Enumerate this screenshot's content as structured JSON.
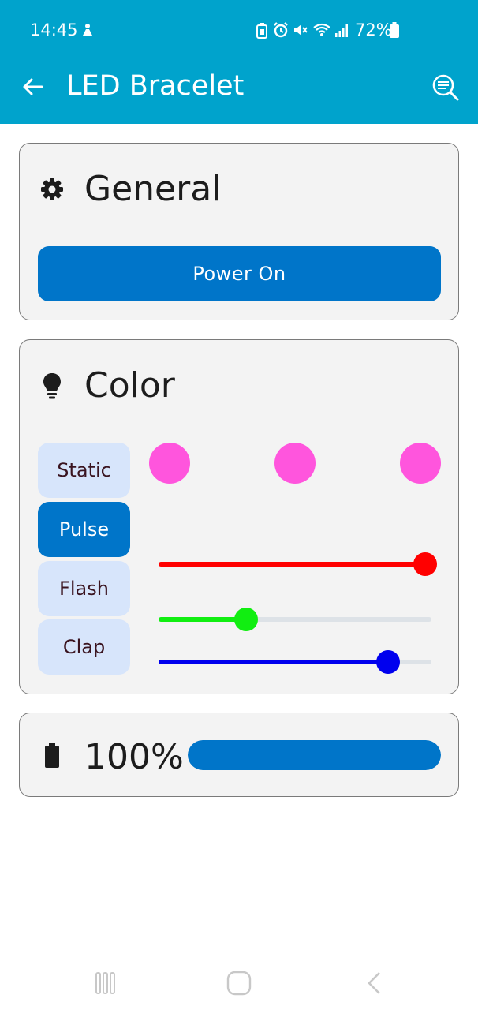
{
  "status_bar": {
    "time": "14:45",
    "battery_text": "72%",
    "icons": [
      "notification-icon",
      "battery-saver-icon",
      "alarm-icon",
      "mute-icon",
      "wifi-icon",
      "signal-icon",
      "battery-icon"
    ]
  },
  "app_bar": {
    "title": "LED Bracelet",
    "back_icon": "arrow-left-icon",
    "search_icon": "search-icon"
  },
  "general": {
    "title": "General",
    "icon": "gear-icon",
    "power_button": "Power On"
  },
  "color": {
    "title": "Color",
    "icon": "lightbulb-icon",
    "modes": [
      "Static",
      "Pulse",
      "Flash",
      "Clap"
    ],
    "selected_mode": "Pulse",
    "swatches": [
      "#ff55dd",
      "#ff55dd",
      "#ff55dd"
    ],
    "sliders": [
      {
        "name": "red",
        "color": "#ff0000",
        "value": 1.0
      },
      {
        "name": "green",
        "color": "#11ee11",
        "value": 0.32
      },
      {
        "name": "blue",
        "color": "#0000ee",
        "value": 0.84
      }
    ]
  },
  "battery": {
    "icon": "battery-icon",
    "percent_text": "100%",
    "level": 1.0,
    "bar_color": "#0075c9"
  },
  "nav_bar": {
    "icons": [
      "recents-icon",
      "home-icon",
      "back-icon"
    ]
  },
  "colors": {
    "app_bar": "#00a3cc",
    "accent": "#0075c9",
    "mode_inactive_bg": "#d7e5fb"
  }
}
